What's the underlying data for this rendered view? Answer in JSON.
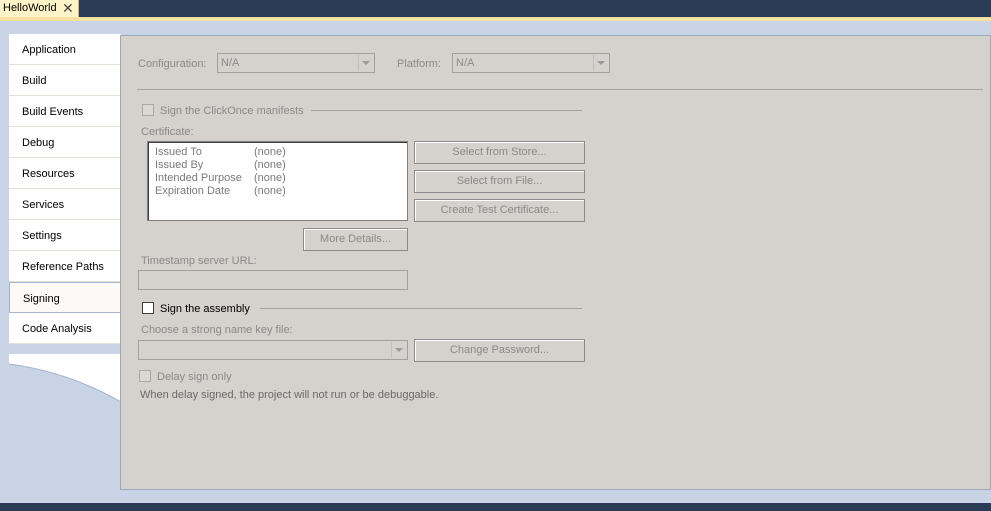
{
  "document_tab": {
    "title": "HelloWorld",
    "close_glyph": "✕"
  },
  "nav": {
    "items": [
      {
        "label": "Application"
      },
      {
        "label": "Build"
      },
      {
        "label": "Build Events"
      },
      {
        "label": "Debug"
      },
      {
        "label": "Resources"
      },
      {
        "label": "Services"
      },
      {
        "label": "Settings"
      },
      {
        "label": "Reference Paths"
      },
      {
        "label": "Signing",
        "active": true
      },
      {
        "label": "Code Analysis"
      }
    ]
  },
  "config": {
    "configuration_label": "Configuration:",
    "configuration_value": "N/A",
    "platform_label": "Platform:",
    "platform_value": "N/A"
  },
  "clickonce": {
    "sign_label": "Sign the ClickOnce manifests",
    "sign_checked": false,
    "certificate_label": "Certificate:",
    "certificate_rows": [
      {
        "key": "Issued To",
        "value": "(none)"
      },
      {
        "key": "Issued By",
        "value": "(none)"
      },
      {
        "key": "Intended Purpose",
        "value": "(none)"
      },
      {
        "key": "Expiration Date",
        "value": "(none)"
      }
    ],
    "select_store_button": "Select from Store...",
    "select_file_button": "Select from File...",
    "create_test_button": "Create Test Certificate...",
    "more_details_button": "More Details...",
    "timestamp_label": "Timestamp server URL:",
    "timestamp_value": ""
  },
  "assembly": {
    "sign_label": "Sign the assembly",
    "sign_checked": false,
    "key_file_label": "Choose a strong name key file:",
    "key_file_value": "",
    "change_password_button": "Change Password...",
    "delay_sign_label": "Delay sign only",
    "delay_sign_checked": false,
    "delay_sign_note": "When delay signed, the project will not run or be debuggable."
  },
  "colors": {
    "frame": "#2b3a55",
    "workspace": "#c9d3e6",
    "panel": "#d5d1cc",
    "doc_tab": "#fcf3c8",
    "disabled_text": "#8a8a8a"
  }
}
